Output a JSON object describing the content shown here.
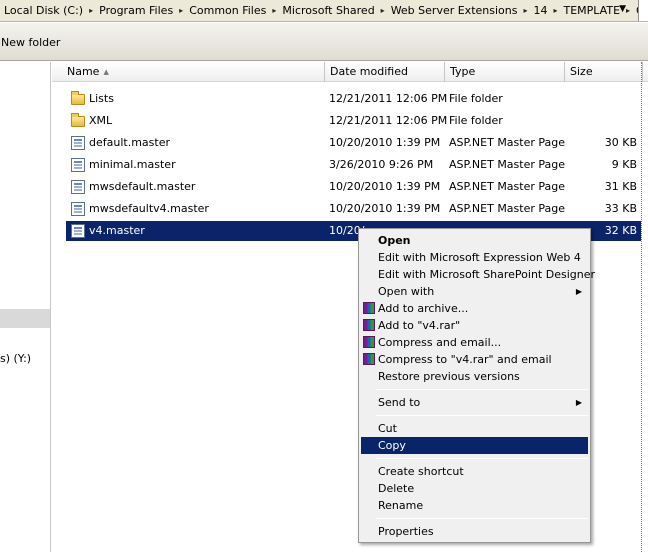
{
  "address": {
    "crumbs": [
      "Local Disk (C:)",
      "Program Files",
      "Common Files",
      "Microsoft Shared",
      "Web Server Extensions",
      "14",
      "TEMPLATE",
      "GLOBAL"
    ]
  },
  "toolbar": {
    "new_folder_label": "New folder"
  },
  "nav": {
    "drive_label": "s) (Y:)"
  },
  "columns": {
    "name": "Name",
    "date": "Date modified",
    "type": "Type",
    "size": "Size"
  },
  "files": [
    {
      "name": "Lists",
      "date": "12/21/2011 12:06 PM",
      "type": "File folder",
      "size": "",
      "icon": "folder-icon"
    },
    {
      "name": "XML",
      "date": "12/21/2011 12:06 PM",
      "type": "File folder",
      "size": "",
      "icon": "folder-icon"
    },
    {
      "name": "default.master",
      "date": "10/20/2010 1:39 PM",
      "type": "ASP.NET Master Page",
      "size": "30 KB",
      "icon": "master-page-icon"
    },
    {
      "name": "minimal.master",
      "date": "3/26/2010 9:26 PM",
      "type": "ASP.NET Master Page",
      "size": "9 KB",
      "icon": "master-page-icon"
    },
    {
      "name": "mwsdefault.master",
      "date": "10/20/2010 1:39 PM",
      "type": "ASP.NET Master Page",
      "size": "31 KB",
      "icon": "master-page-icon"
    },
    {
      "name": "mwsdefaultv4.master",
      "date": "10/20/2010 1:39 PM",
      "type": "ASP.NET Master Page",
      "size": "33 KB",
      "icon": "master-page-icon"
    },
    {
      "name": "v4.master",
      "date": "10/20/",
      "type": "",
      "size": "32 KB",
      "icon": "master-page-icon",
      "selected": true
    }
  ],
  "context_menu": {
    "open": "Open",
    "edit_expression": "Edit with Microsoft Expression Web 4",
    "edit_sharepoint": "Edit with Microsoft SharePoint Designer",
    "open_with": "Open with",
    "add_archive": "Add to archive...",
    "add_rar": "Add to \"v4.rar\"",
    "compress_email": "Compress and email...",
    "compress_rar_email": "Compress to \"v4.rar\" and email",
    "restore": "Restore previous versions",
    "send_to": "Send to",
    "cut": "Cut",
    "copy": "Copy",
    "create_shortcut": "Create shortcut",
    "delete": "Delete",
    "rename": "Rename",
    "properties": "Properties"
  },
  "colors": {
    "selection": "#0a246a",
    "menu_bg": "#f0f0f0"
  }
}
